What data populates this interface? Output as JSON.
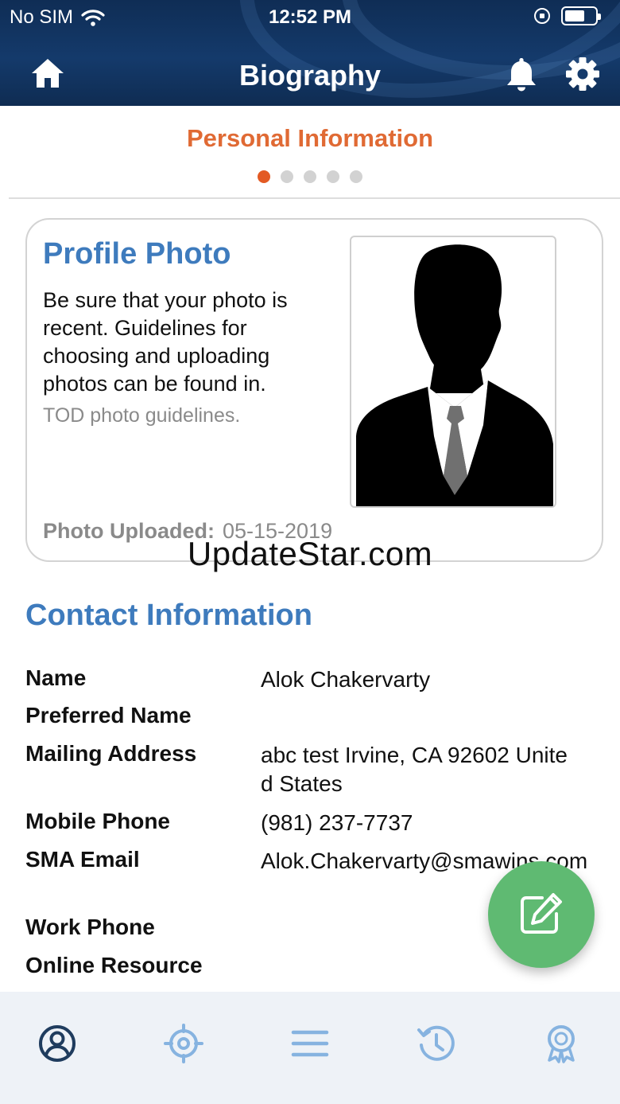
{
  "status_bar": {
    "carrier": "No SIM",
    "time": "12:52 PM"
  },
  "nav": {
    "title": "Biography"
  },
  "pager": {
    "section_title": "Personal Information",
    "page_count": 5,
    "active_page": 1
  },
  "profile_card": {
    "title": "Profile Photo",
    "description": "Be sure that your photo is recent. Guidelines for choosing and uploading photos can be found in.",
    "link_text": "TOD photo guidelines.",
    "uploaded_label": "Photo Uploaded:",
    "uploaded_date": "05-15-2019"
  },
  "watermark": "UpdateStar.com",
  "contact": {
    "title": "Contact Information",
    "fields": [
      {
        "label": "Name",
        "value": "Alok Chakervarty"
      },
      {
        "label": "Preferred Name",
        "value": ""
      },
      {
        "label": "Mailing Address",
        "value": "abc test  Irvine, CA 92602 United States"
      },
      {
        "label": "Mobile Phone",
        "value": "(981) 237-7737"
      },
      {
        "label": "SMA Email",
        "value": "Alok.Chakervarty@smawins.com"
      },
      {
        "label": "Work Phone",
        "value": ""
      },
      {
        "label": "Online Resource",
        "value": ""
      }
    ]
  },
  "tabs": [
    {
      "icon": "profile-icon",
      "active": true
    },
    {
      "icon": "target-icon",
      "active": false
    },
    {
      "icon": "list-icon",
      "active": false
    },
    {
      "icon": "history-icon",
      "active": false
    },
    {
      "icon": "award-icon",
      "active": false
    }
  ],
  "colors": {
    "header_bg": "#143a6b",
    "accent_orange": "#e06a34",
    "heading_blue": "#3e7bbd",
    "fab_green": "#5fba72",
    "tab_active": "#1f3c5e",
    "tab_inactive": "#86b3e0"
  }
}
